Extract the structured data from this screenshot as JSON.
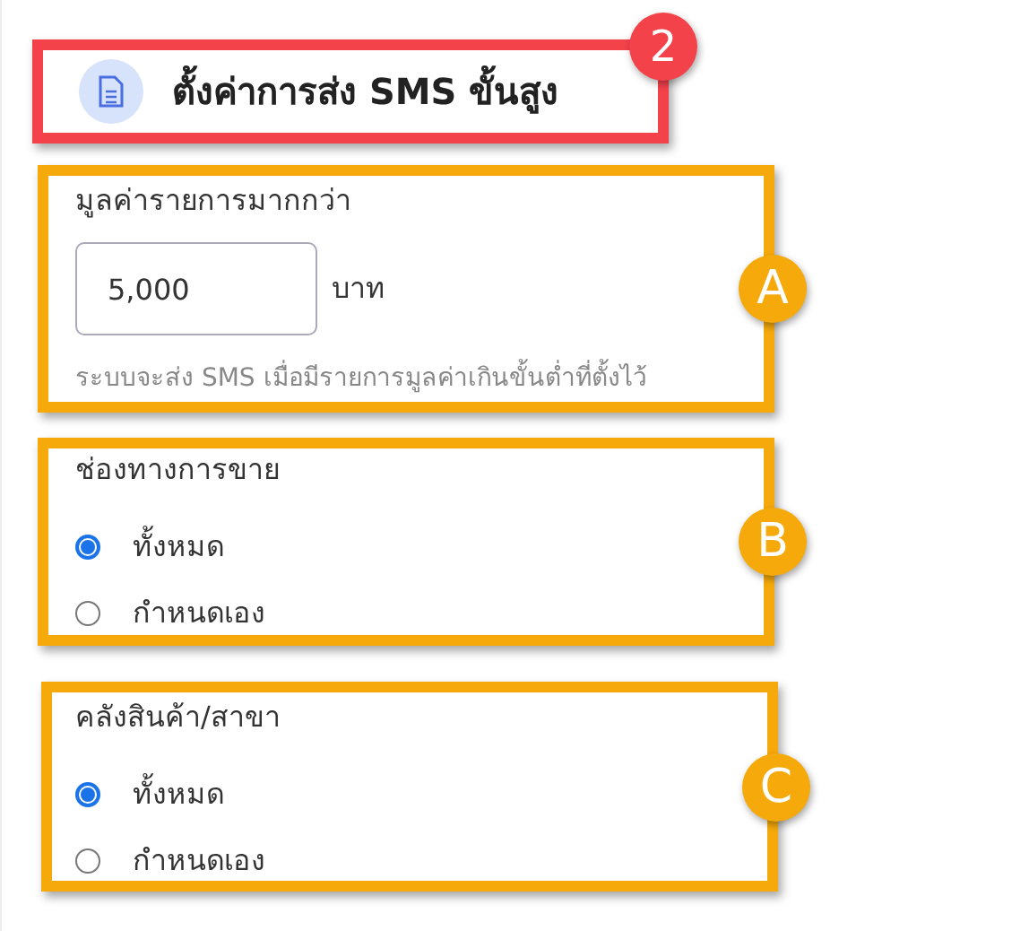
{
  "header": {
    "title": "ตั้งค่าการส่ง SMS ขั้นสูง",
    "badge": "2"
  },
  "sections": [
    {
      "kind": "amount",
      "badge": "A",
      "label": "มูลค่ารายการมากกว่า",
      "value": "5,000",
      "unit": "บาท",
      "hint": "ระบบจะส่ง SMS เมื่อมีรายการมูลค่าเกินขั้นต่ำที่ตั้งไว้"
    },
    {
      "kind": "radio",
      "badge": "B",
      "label": "ช่องทางการขาย",
      "options": [
        {
          "label": "ทั้งหมด",
          "selected": true
        },
        {
          "label": "กำหนดเอง",
          "selected": false
        }
      ]
    },
    {
      "kind": "radio",
      "badge": "C",
      "label": "คลังสินค้า/สาขา",
      "options": [
        {
          "label": "ทั้งหมด",
          "selected": true
        },
        {
          "label": "กำหนดเอง",
          "selected": false
        }
      ]
    }
  ]
}
